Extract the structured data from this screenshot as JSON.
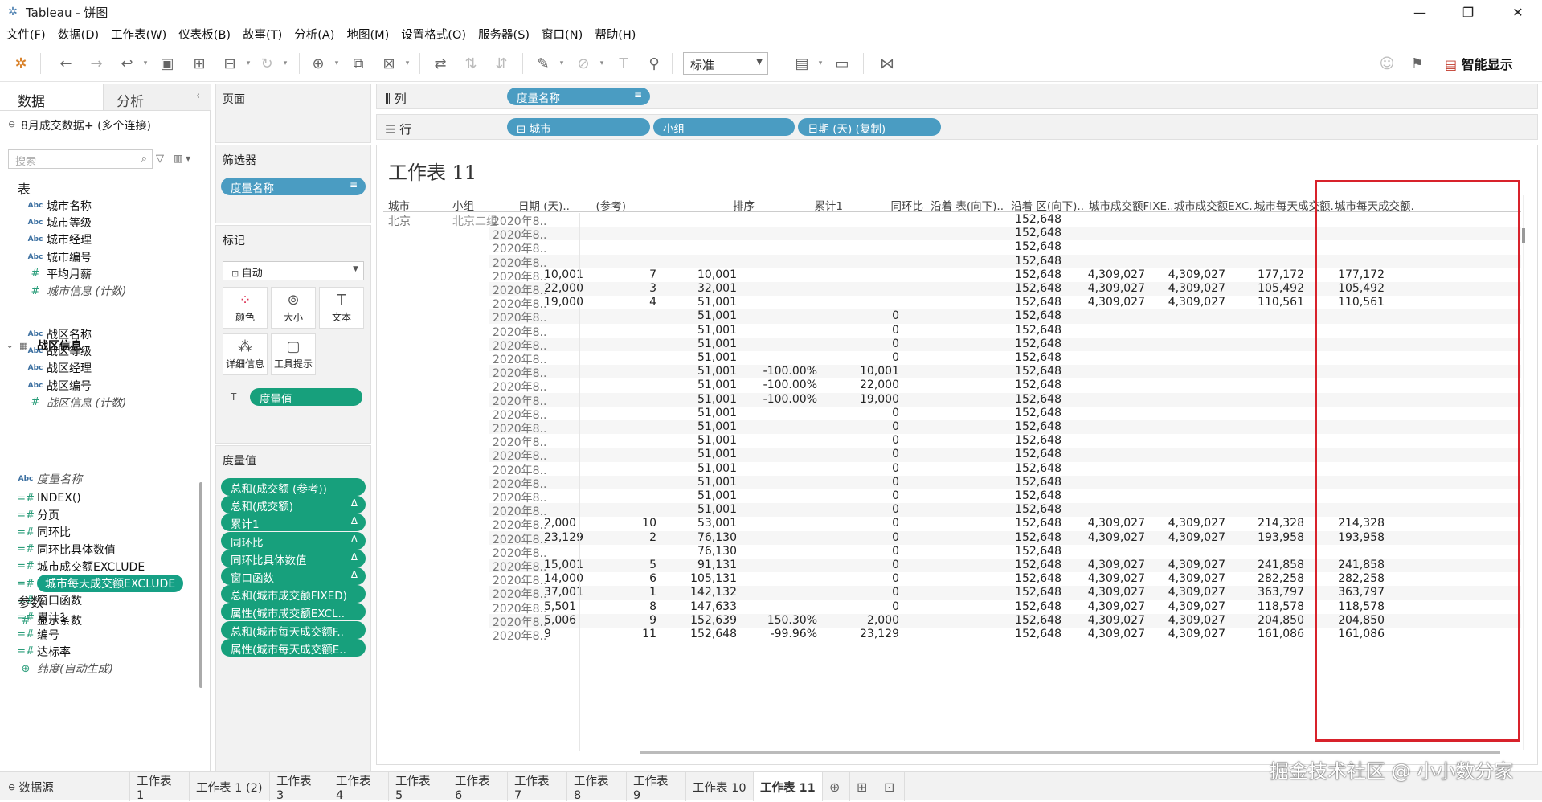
{
  "window": {
    "title": "Tableau - 饼图"
  },
  "menu": [
    "文件(F)",
    "数据(D)",
    "工作表(W)",
    "仪表板(B)",
    "故事(T)",
    "分析(A)",
    "地图(M)",
    "设置格式(O)",
    "服务器(S)",
    "窗口(N)",
    "帮助(H)"
  ],
  "toolbar": {
    "fit_value": "标准",
    "smart_show": "智能显示"
  },
  "left": {
    "tab_data": "数据",
    "tab_analysis": "分析",
    "datasource": "8月成交数据+ (多个连接)",
    "search_placeholder": "搜索",
    "tables_heading": "表",
    "city_fields": [
      {
        "icon": "Abc",
        "label": "城市名称"
      },
      {
        "icon": "Abc",
        "label": "城市等级"
      },
      {
        "icon": "Abc",
        "label": "城市经理"
      },
      {
        "icon": "Abc",
        "label": "城市编号"
      },
      {
        "icon": "#",
        "label": "平均月薪"
      },
      {
        "icon": "#",
        "label": "城市信息 (计数)"
      }
    ],
    "region_table": "战区信息",
    "region_fields": [
      {
        "icon": "Abc",
        "label": "战区名称"
      },
      {
        "icon": "Abc",
        "label": "战区等级"
      },
      {
        "icon": "Abc",
        "label": "战区经理"
      },
      {
        "icon": "Abc",
        "label": "战区编号"
      },
      {
        "icon": "#",
        "label": "战区信息 (计数)"
      }
    ],
    "measure_names": "度量名称",
    "calc_fields": [
      "INDEX()",
      "分页",
      "同环比",
      "同环比具体数值",
      "城市成交额EXCLUDE",
      "城市每天成交额EXCLUDE",
      "窗口函数",
      "累计1",
      "编号",
      "达标率",
      "纬度(自动生成)"
    ],
    "params_heading": "参数",
    "params": [
      "显示条数"
    ]
  },
  "shelves": {
    "pages": "页面",
    "filters": "筛选器",
    "filter_pill": "度量名称",
    "marks": "标记",
    "marks_type": "自动",
    "mark_buttons": [
      "颜色",
      "大小",
      "文本",
      "详细信息",
      "工具提示"
    ],
    "marks_pill": "度量值",
    "measure_values_title": "度量值",
    "measure_values": [
      "总和(成交额 (参考))",
      "总和(成交额)",
      "累计1",
      "同环比",
      "同环比具体数值",
      "窗口函数",
      "总和(城市成交额FIXED)",
      "属性(城市成交额EXCL..",
      "总和(城市每天成交额F..",
      "属性(城市每天成交额E.."
    ],
    "columns_label": "列",
    "columns_pills": [
      "度量名称"
    ],
    "rows_label": "行",
    "rows_pills": [
      "城市",
      "小组",
      "日期 (天) (复制)"
    ]
  },
  "view": {
    "title": "工作表 11",
    "headers": [
      "城市",
      "小组",
      "日期 (天)..",
      "(参考)",
      "排序",
      "累计1",
      "同环比",
      "沿着 表(向下)..",
      "沿着 区(向下)..",
      "城市成交额FIXE..",
      "城市成交额EXC..",
      "城市每天成交额..",
      "城市每天成交额.."
    ],
    "city": "北京",
    "group": "北京二组",
    "date_label": "2020年8..",
    "rows": [
      [
        "",
        "",
        "",
        "",
        "",
        "",
        "152,648",
        "",
        "",
        "",
        ""
      ],
      [
        "",
        "",
        "",
        "",
        "",
        "",
        "152,648",
        "",
        "",
        "",
        ""
      ],
      [
        "",
        "",
        "",
        "",
        "",
        "",
        "152,648",
        "",
        "",
        "",
        ""
      ],
      [
        "",
        "",
        "",
        "",
        "",
        "",
        "152,648",
        "",
        "",
        "",
        ""
      ],
      [
        "10,001",
        "7",
        "10,001",
        "",
        "",
        "",
        "152,648",
        "4,309,027",
        "4,309,027",
        "177,172",
        "177,172"
      ],
      [
        "22,000",
        "3",
        "32,001",
        "",
        "",
        "",
        "152,648",
        "4,309,027",
        "4,309,027",
        "105,492",
        "105,492"
      ],
      [
        "19,000",
        "4",
        "51,001",
        "",
        "",
        "",
        "152,648",
        "4,309,027",
        "4,309,027",
        "110,561",
        "110,561"
      ],
      [
        "",
        "",
        "51,001",
        "",
        "0",
        "",
        "152,648",
        "",
        "",
        "",
        ""
      ],
      [
        "",
        "",
        "51,001",
        "",
        "0",
        "",
        "152,648",
        "",
        "",
        "",
        ""
      ],
      [
        "",
        "",
        "51,001",
        "",
        "0",
        "",
        "152,648",
        "",
        "",
        "",
        ""
      ],
      [
        "",
        "",
        "51,001",
        "",
        "0",
        "",
        "152,648",
        "",
        "",
        "",
        ""
      ],
      [
        "",
        "",
        "51,001",
        "-100.00%",
        "10,001",
        "",
        "152,648",
        "",
        "",
        "",
        ""
      ],
      [
        "",
        "",
        "51,001",
        "-100.00%",
        "22,000",
        "",
        "152,648",
        "",
        "",
        "",
        ""
      ],
      [
        "",
        "",
        "51,001",
        "-100.00%",
        "19,000",
        "",
        "152,648",
        "",
        "",
        "",
        ""
      ],
      [
        "",
        "",
        "51,001",
        "",
        "0",
        "",
        "152,648",
        "",
        "",
        "",
        ""
      ],
      [
        "",
        "",
        "51,001",
        "",
        "0",
        "",
        "152,648",
        "",
        "",
        "",
        ""
      ],
      [
        "",
        "",
        "51,001",
        "",
        "0",
        "",
        "152,648",
        "",
        "",
        "",
        ""
      ],
      [
        "",
        "",
        "51,001",
        "",
        "0",
        "",
        "152,648",
        "",
        "",
        "",
        ""
      ],
      [
        "",
        "",
        "51,001",
        "",
        "0",
        "",
        "152,648",
        "",
        "",
        "",
        ""
      ],
      [
        "",
        "",
        "51,001",
        "",
        "0",
        "",
        "152,648",
        "",
        "",
        "",
        ""
      ],
      [
        "",
        "",
        "51,001",
        "",
        "0",
        "",
        "152,648",
        "",
        "",
        "",
        ""
      ],
      [
        "",
        "",
        "51,001",
        "",
        "0",
        "",
        "152,648",
        "",
        "",
        "",
        ""
      ],
      [
        "2,000",
        "10",
        "53,001",
        "",
        "0",
        "",
        "152,648",
        "4,309,027",
        "4,309,027",
        "214,328",
        "214,328"
      ],
      [
        "23,129",
        "2",
        "76,130",
        "",
        "0",
        "",
        "152,648",
        "4,309,027",
        "4,309,027",
        "193,958",
        "193,958"
      ],
      [
        "",
        "",
        "76,130",
        "",
        "0",
        "",
        "152,648",
        "",
        "",
        "",
        ""
      ],
      [
        "15,001",
        "5",
        "91,131",
        "",
        "0",
        "",
        "152,648",
        "4,309,027",
        "4,309,027",
        "241,858",
        "241,858"
      ],
      [
        "14,000",
        "6",
        "105,131",
        "",
        "0",
        "",
        "152,648",
        "4,309,027",
        "4,309,027",
        "282,258",
        "282,258"
      ],
      [
        "37,001",
        "1",
        "142,132",
        "",
        "0",
        "",
        "152,648",
        "4,309,027",
        "4,309,027",
        "363,797",
        "363,797"
      ],
      [
        "5,501",
        "8",
        "147,633",
        "",
        "0",
        "",
        "152,648",
        "4,309,027",
        "4,309,027",
        "118,578",
        "118,578"
      ],
      [
        "5,006",
        "9",
        "152,639",
        "150.30%",
        "2,000",
        "",
        "152,648",
        "4,309,027",
        "4,309,027",
        "204,850",
        "204,850"
      ],
      [
        "9",
        "11",
        "152,648",
        "-99.96%",
        "23,129",
        "",
        "152,648",
        "4,309,027",
        "4,309,027",
        "161,086",
        "161,086"
      ]
    ]
  },
  "bottom": {
    "datasource_tab": "数据源",
    "sheets": [
      "工作表 1",
      "工作表 1 (2)",
      "工作表 3",
      "工作表 4",
      "工作表 5",
      "工作表 6",
      "工作表 7",
      "工作表 8",
      "工作表 9",
      "工作表 10",
      "工作表 11"
    ],
    "active": "工作表 11"
  },
  "watermark": "掘金技术社区 @ 小小数分家",
  "colors": {
    "pill_blue": "#4a9cc2",
    "pill_green": "#17a07c",
    "highlight_box": "#d8222b"
  }
}
